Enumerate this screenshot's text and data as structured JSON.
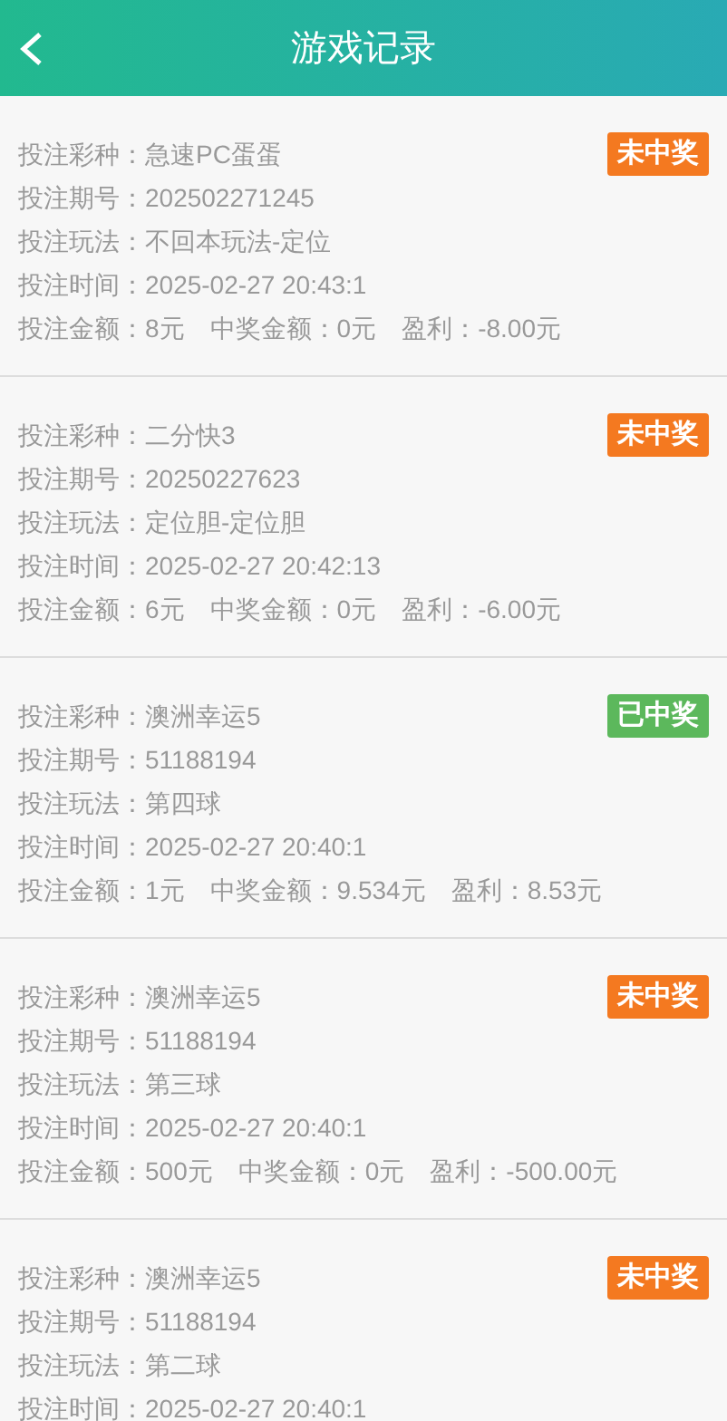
{
  "header": {
    "title": "游戏记录"
  },
  "records": [
    {
      "status": {
        "label": "未中奖",
        "kind": "lost"
      },
      "lines": [
        "投注彩种：急速PC蛋蛋",
        "投注期号：202502271245",
        "投注玩法：不回本玩法-定位",
        "投注时间：2025-02-27 20:43:1"
      ],
      "amounts": [
        "投注金额：8元",
        "中奖金额：0元",
        "盈利：-8.00元"
      ]
    },
    {
      "status": {
        "label": "未中奖",
        "kind": "lost"
      },
      "lines": [
        "投注彩种：二分快3",
        "投注期号：20250227623",
        "投注玩法：定位胆-定位胆",
        "投注时间：2025-02-27 20:42:13"
      ],
      "amounts": [
        "投注金额：6元",
        "中奖金额：0元",
        "盈利：-6.00元"
      ]
    },
    {
      "status": {
        "label": "已中奖",
        "kind": "won"
      },
      "lines": [
        "投注彩种：澳洲幸运5",
        "投注期号：51188194",
        "投注玩法：第四球",
        "投注时间：2025-02-27 20:40:1"
      ],
      "amounts": [
        "投注金额：1元",
        "中奖金额：9.534元",
        "盈利：8.53元"
      ]
    },
    {
      "status": {
        "label": "未中奖",
        "kind": "lost"
      },
      "lines": [
        "投注彩种：澳洲幸运5",
        "投注期号：51188194",
        "投注玩法：第三球",
        "投注时间：2025-02-27 20:40:1"
      ],
      "amounts": [
        "投注金额：500元",
        "中奖金额：0元",
        "盈利：-500.00元"
      ]
    },
    {
      "status": {
        "label": "未中奖",
        "kind": "lost"
      },
      "lines": [
        "投注彩种：澳洲幸运5",
        "投注期号：51188194",
        "投注玩法：第二球",
        "投注时间：2025-02-27 20:40:1"
      ]
    }
  ]
}
